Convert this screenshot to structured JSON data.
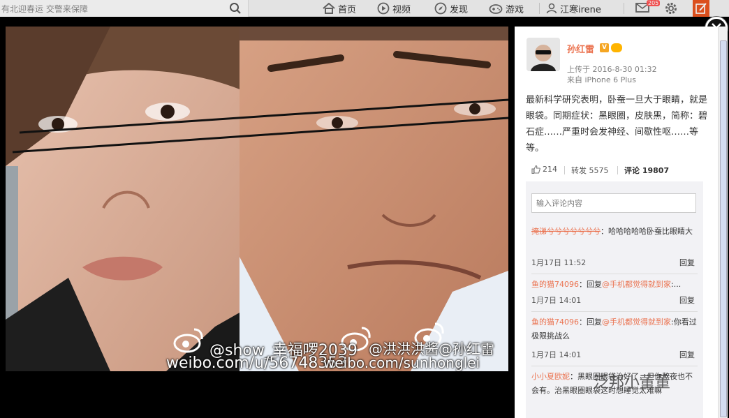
{
  "topbar": {
    "search_placeholder": "有北迎春运 交警来保障",
    "nav": {
      "home": "首页",
      "video": "视频",
      "discover": "发现",
      "games": "游戏",
      "user": "江寒irene"
    },
    "mail_badge": "205"
  },
  "photo": {
    "watermark_user": "@show_幸福啰2039",
    "watermark_url": "weibo.com/u/56748353",
    "watermark_overlap": "@洪洪洪酱@孙红雷",
    "watermark_overlap_url": "weibo.com/sunhonglei"
  },
  "post": {
    "author": "孙红雷",
    "vip_badge": "V",
    "upload_time": "上传于 2016-8-30 01:32",
    "source": "来自 iPhone 6 Plus",
    "text": "最新科学研究表明，卧蚕一旦大于眼睛，就是眼袋。同期症状：黑眼圈，皮肤黑，简称：碧石症……严重时会发神经、间歇性呕……等等。",
    "likes": "214",
    "reposts": "转发 5575",
    "comments": "评论 19807"
  },
  "comment_input_placeholder": "输入评论内容",
  "comments": [
    {
      "name": "掩涕兮兮兮兮兮兮兮",
      "text": "：哈哈哈哈哈卧蚕比眼睛大",
      "time": "1月17日 11:52",
      "reply": "回复"
    },
    {
      "name": "鱼的猫74096",
      "text": "：回复",
      "mention": "@手机都觉得就到家",
      "tail": ":...",
      "time": "1月7日 14:01",
      "reply": "回复"
    },
    {
      "name": "鱼的猫74096",
      "text": "：回复",
      "mention": "@手机都觉得就到家",
      "tail": ":你看过极限挑战么",
      "time": "1月7日 14:01",
      "reply": "回复"
    },
    {
      "name": "小小夏欧妮",
      "text": "：黑眼圈眼袋治好了，但你熬夜也不会有。治黑眼圈眼袋这时想睡觉太难嘛"
    }
  ],
  "overlay_logo": "泛邦小董董"
}
